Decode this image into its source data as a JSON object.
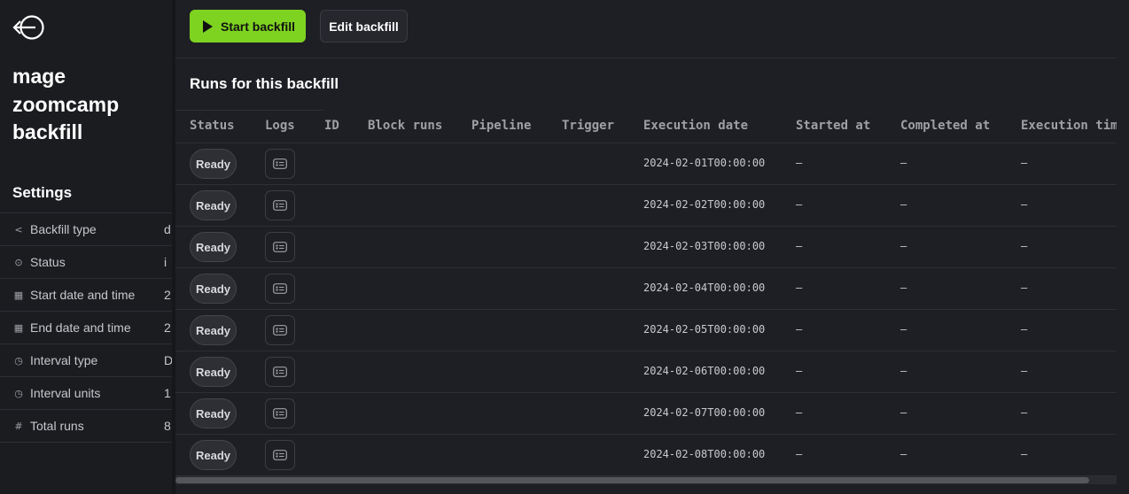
{
  "sidebar": {
    "pipeline_title_lines": [
      "mage",
      "zoomcamp",
      "backfill"
    ],
    "settings_title": "Settings",
    "settings": [
      {
        "icon": "share-icon",
        "label": "Backfill type",
        "value": "d"
      },
      {
        "icon": "toggle-icon",
        "label": "Status",
        "value": "i"
      },
      {
        "icon": "calendar-icon",
        "label": "Start date and time",
        "value": "2"
      },
      {
        "icon": "calendar-icon",
        "label": "End date and time",
        "value": "2"
      },
      {
        "icon": "clock-icon",
        "label": "Interval type",
        "value": "D"
      },
      {
        "icon": "clock-icon",
        "label": "Interval units",
        "value": "1"
      },
      {
        "icon": "hash-icon",
        "label": "Total runs",
        "value": "8"
      }
    ]
  },
  "toolbar": {
    "start_label": "Start backfill",
    "edit_label": "Edit backfill",
    "start_color": "#7ed321"
  },
  "runs": {
    "title": "Runs for this backfill",
    "columns": [
      "Status",
      "Logs",
      "ID",
      "Block runs",
      "Pipeline",
      "Trigger",
      "Execution date",
      "Started at",
      "Completed at",
      "Execution time"
    ],
    "rows": [
      {
        "status": "Ready",
        "execution_date": "2024-02-01T00:00:00",
        "started_at": "—",
        "completed_at": "—",
        "execution_time": "—"
      },
      {
        "status": "Ready",
        "execution_date": "2024-02-02T00:00:00",
        "started_at": "—",
        "completed_at": "—",
        "execution_time": "—"
      },
      {
        "status": "Ready",
        "execution_date": "2024-02-03T00:00:00",
        "started_at": "—",
        "completed_at": "—",
        "execution_time": "—"
      },
      {
        "status": "Ready",
        "execution_date": "2024-02-04T00:00:00",
        "started_at": "—",
        "completed_at": "—",
        "execution_time": "—"
      },
      {
        "status": "Ready",
        "execution_date": "2024-02-05T00:00:00",
        "started_at": "—",
        "completed_at": "—",
        "execution_time": "—"
      },
      {
        "status": "Ready",
        "execution_date": "2024-02-06T00:00:00",
        "started_at": "—",
        "completed_at": "—",
        "execution_time": "—"
      },
      {
        "status": "Ready",
        "execution_date": "2024-02-07T00:00:00",
        "started_at": "—",
        "completed_at": "—",
        "execution_time": "—"
      },
      {
        "status": "Ready",
        "execution_date": "2024-02-08T00:00:00",
        "started_at": "—",
        "completed_at": "—",
        "execution_time": "—"
      }
    ]
  }
}
